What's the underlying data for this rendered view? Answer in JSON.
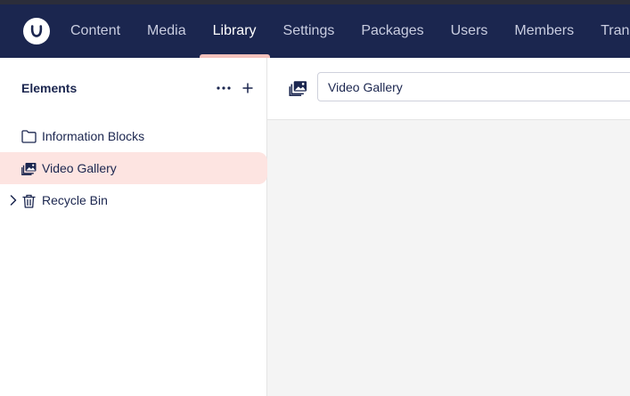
{
  "nav": {
    "logo_icon": "umbraco-logo-icon",
    "items": [
      {
        "label": "Content",
        "active": false
      },
      {
        "label": "Media",
        "active": false
      },
      {
        "label": "Library",
        "active": true
      },
      {
        "label": "Settings",
        "active": false
      },
      {
        "label": "Packages",
        "active": false
      },
      {
        "label": "Users",
        "active": false
      },
      {
        "label": "Members",
        "active": false
      },
      {
        "label": "Transl",
        "active": false
      }
    ]
  },
  "colors": {
    "topbar": "#1b264f",
    "active_indicator": "#f5c1bc",
    "selected_row": "#fde4e1"
  },
  "sidebar": {
    "title": "Elements",
    "actions": [
      "more-icon",
      "plus-icon"
    ],
    "tree": [
      {
        "label": "Information Blocks",
        "icon": "folder-icon",
        "selected": false,
        "expandable": false
      },
      {
        "label": "Video Gallery",
        "icon": "pictures-icon",
        "selected": true,
        "expandable": false
      },
      {
        "label": "Recycle Bin",
        "icon": "trash-icon",
        "selected": false,
        "expandable": true
      }
    ]
  },
  "editor": {
    "icon": "pictures-icon",
    "name_value": "Video Gallery"
  }
}
